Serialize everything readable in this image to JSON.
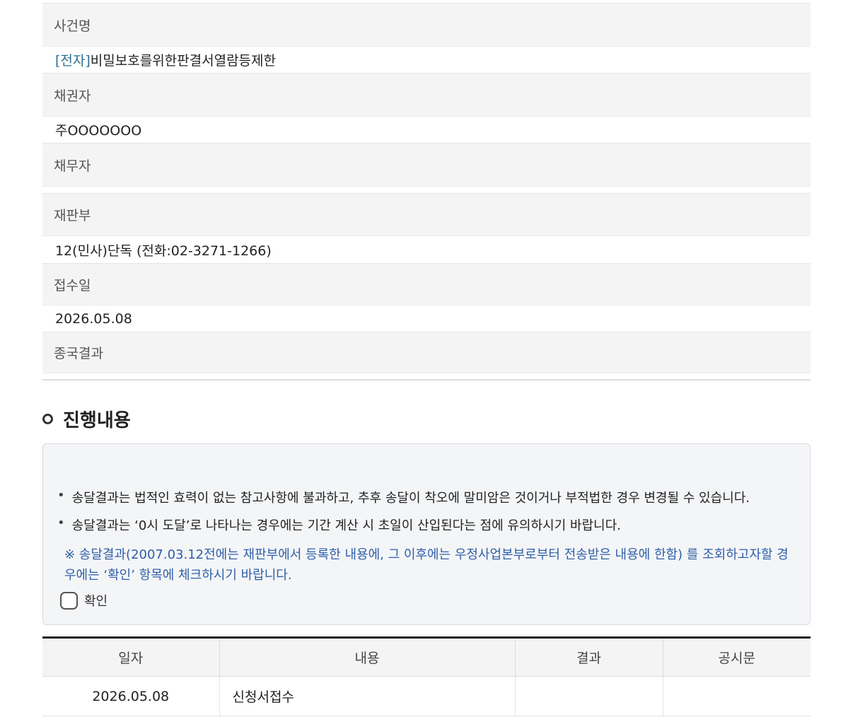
{
  "case_info": {
    "case_name_label": "사건명",
    "case_name_tag": "[전자]",
    "case_name_value": "비밀보호를위한판결서열람등제한",
    "creditor_label": "채권자",
    "creditor_value": "주OOOOOOO",
    "debtor_label": "채무자",
    "court_label": "재판부",
    "court_value": "12(민사)단독 (전화:02-3271-1266)",
    "receipt_date_label": "접수일",
    "receipt_date_value": "2026.05.08",
    "final_result_label": "종국결과"
  },
  "progress": {
    "title": "진행내용",
    "notice": {
      "bullet1": "송달결과는 법적인 효력이 없는 참고사항에 불과하고, 추후 송달이 착오에 말미암은 것이거나 부적법한 경우 변경될 수 있습니다.",
      "bullet2": "송달결과는 ‘0시 도달’로 나타나는 경우에는 기간 계산 시 초일이 산입된다는 점에 유의하시기 바랍니다.",
      "note": "※ 송달결과(2007.03.12전에는 재판부에서 등록한 내용에, 그 이후에는 우정사업본부로부터 전송받은 내용에 한함) 를 조회하고자할 경우에는 ‘확인’ 항목에 체크하시기 바랍니다.",
      "confirm_label": "확인"
    },
    "table": {
      "headers": [
        "일자",
        "내용",
        "결과",
        "공시문"
      ],
      "rows": [
        {
          "date": "2026.05.08",
          "content": "신청서접수",
          "result": "",
          "notice": ""
        }
      ]
    }
  }
}
